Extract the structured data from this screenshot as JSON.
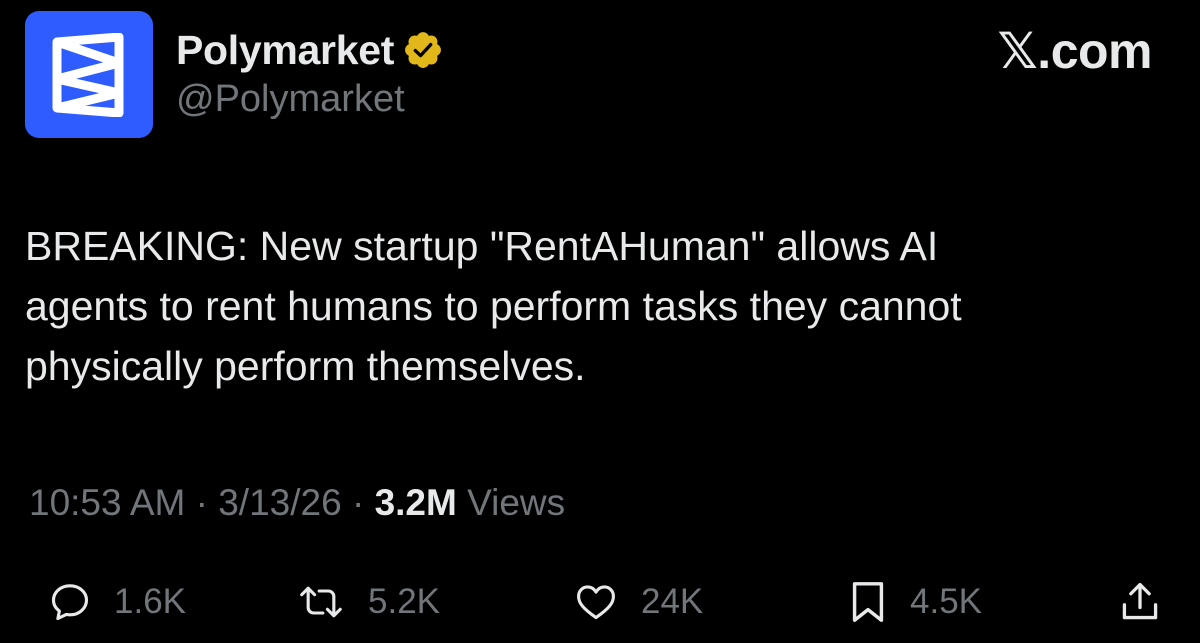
{
  "author": {
    "display_name": "Polymarket",
    "handle": "@Polymarket",
    "verified_badge": "gold-verified-icon",
    "avatar_color": "#2e5cff"
  },
  "brand": {
    "label": "𝕏.com"
  },
  "tweet": {
    "text": "BREAKING: New startup \"RentAHuman\" allows AI\nagents to rent humans to perform tasks they cannot\nphysically perform themselves."
  },
  "meta": {
    "time": "10:53 AM",
    "separator1": " · ",
    "date": "3/13/26",
    "separator2": " · ",
    "views_count": "3.2M",
    "views_label": " Views"
  },
  "actions": {
    "reply": {
      "icon": "reply-icon",
      "count": "1.6K"
    },
    "retweet": {
      "icon": "retweet-icon",
      "count": "5.2K"
    },
    "like": {
      "icon": "heart-icon",
      "count": "24K"
    },
    "bookmark": {
      "icon": "bookmark-icon",
      "count": "4.5K"
    },
    "share": {
      "icon": "share-icon"
    }
  },
  "colors": {
    "background": "#000000",
    "text_primary": "#e7e9ea",
    "text_secondary": "#71767b",
    "verified_gold": "#e2b719"
  }
}
